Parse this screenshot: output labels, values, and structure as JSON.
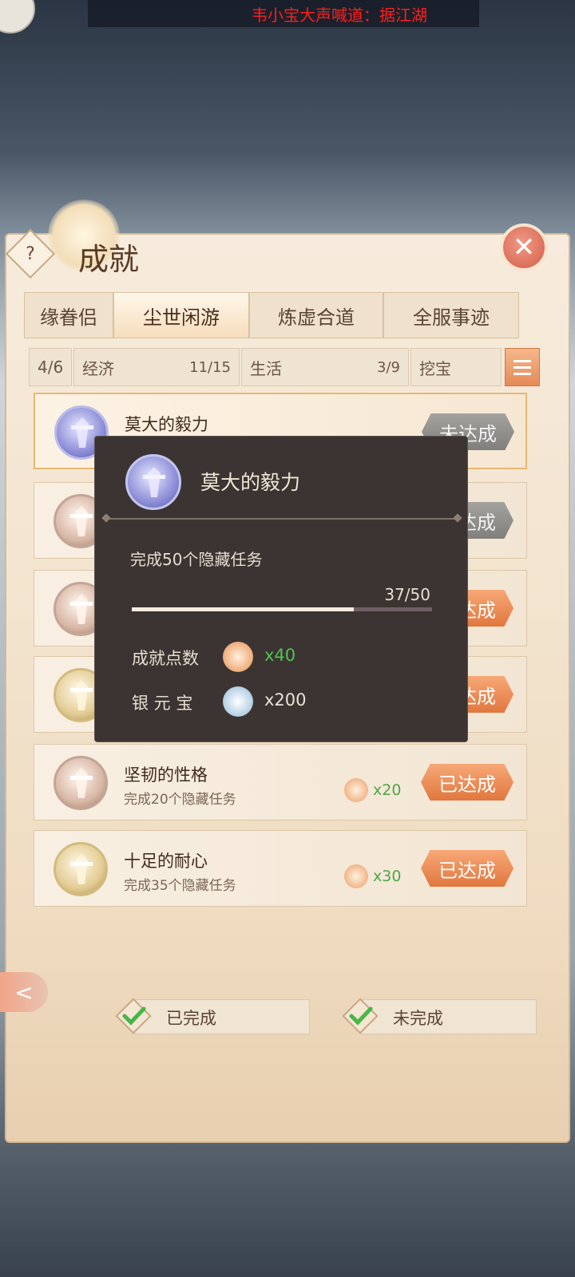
{
  "broadcast": "韦小宝大声喊道：据江湖",
  "panel": {
    "title": "成就",
    "help": "?"
  },
  "tabs": [
    {
      "label": "缘眷侣",
      "active": false
    },
    {
      "label": "尘世闲游",
      "active": true
    },
    {
      "label": "炼虚合道",
      "active": false
    },
    {
      "label": "全服事迹",
      "active": false
    }
  ],
  "subcategories": [
    {
      "name": "4/6",
      "count": ""
    },
    {
      "name": "经济",
      "count": "11/15"
    },
    {
      "name": "生活",
      "count": "3/9"
    },
    {
      "name": "挖宝",
      "count": ""
    }
  ],
  "achievements": [
    {
      "name": "莫大的毅力",
      "desc": "",
      "points": "",
      "status": "未达成",
      "badge": "purple"
    },
    {
      "name": "",
      "desc": "",
      "points": "",
      "status": "未达成",
      "badge": "bronze"
    },
    {
      "name": "",
      "desc": "",
      "points": "",
      "status": "已达成",
      "badge": "bronze"
    },
    {
      "name": "",
      "desc": "",
      "points": "",
      "status": "已达成",
      "badge": "gold"
    },
    {
      "name": "坚韧的性格",
      "desc": "完成20个隐藏任务",
      "points": "x20",
      "status": "已达成",
      "badge": "bronze"
    },
    {
      "name": "十足的耐心",
      "desc": "完成35个隐藏任务",
      "points": "x30",
      "status": "已达成",
      "badge": "gold"
    }
  ],
  "tooltip": {
    "title": "莫大的毅力",
    "desc": "完成50个隐藏任务",
    "progress": "37/50",
    "progress_fraction": 0.74,
    "reward_points_label": "成就点数",
    "reward_points_value": "x40",
    "reward_silver_label": "银 元 宝",
    "reward_silver_value": "x200"
  },
  "filters": {
    "completed": "已完成",
    "incomplete": "未完成"
  },
  "colors": {
    "accent": "#e58a58",
    "green_value": "#4ca745"
  }
}
